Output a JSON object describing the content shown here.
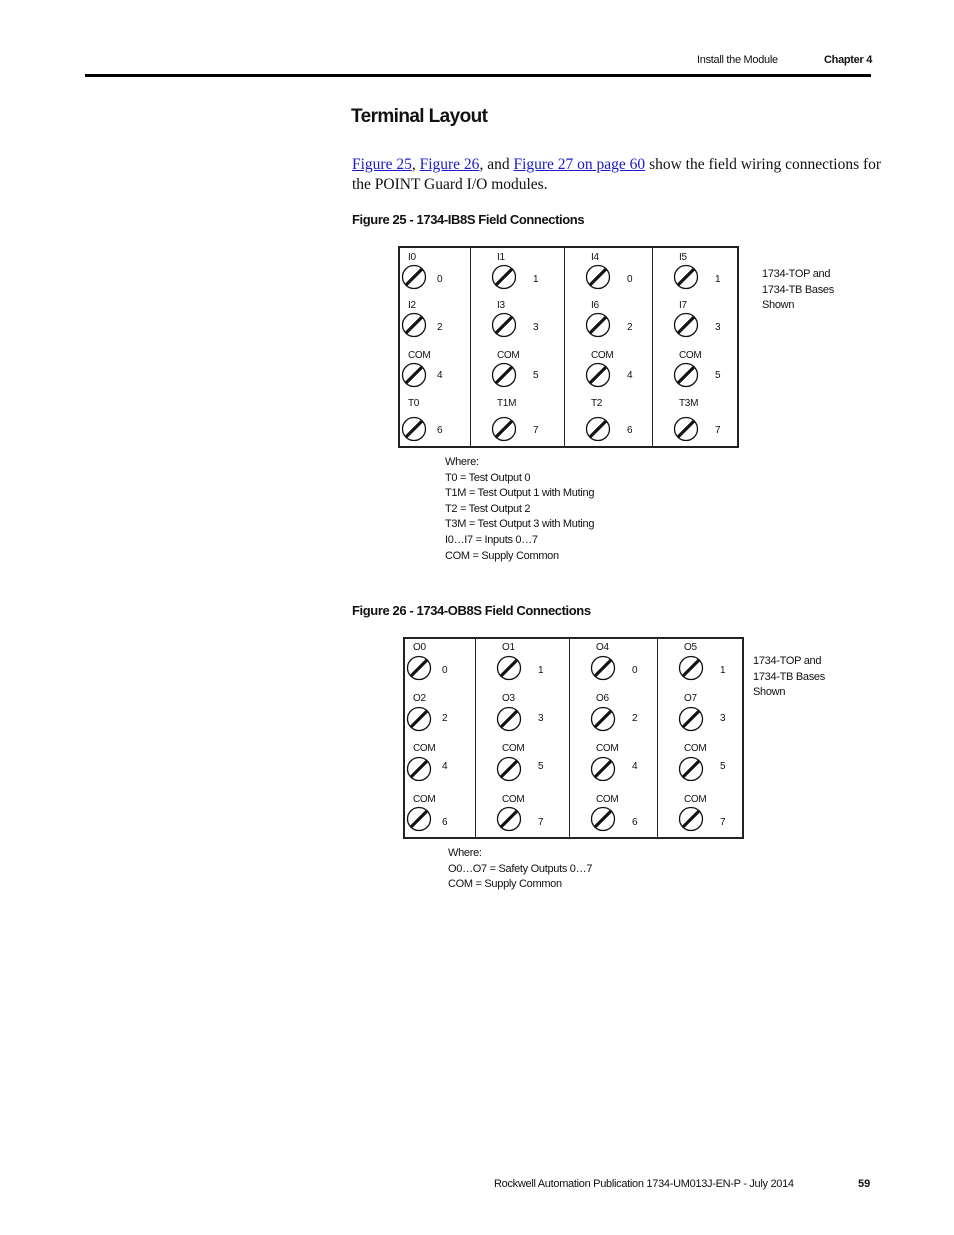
{
  "header": {
    "section": "Install the Module",
    "chapter": "Chapter 4"
  },
  "title": "Terminal Layout",
  "intro": {
    "links": [
      "Figure 25",
      "Figure 26",
      "Figure 27 on page 60"
    ],
    "sep1": ", ",
    "sep2": ", and ",
    "text": " show the field wiring connections for the POINT Guard I/O modules."
  },
  "figures": [
    {
      "caption": "Figure 25 - 1734-IB8S Field Connections",
      "side_note": [
        "1734-TOP and",
        "1734-TB Bases",
        "Shown"
      ],
      "columns": [
        [
          {
            "label": "I0",
            "num": "0"
          },
          {
            "label": "I2",
            "num": "2"
          },
          {
            "label": "COM",
            "num": "4"
          },
          {
            "label": "T0",
            "num": "6"
          }
        ],
        [
          {
            "label": "I1",
            "num": "1"
          },
          {
            "label": "I3",
            "num": "3"
          },
          {
            "label": "COM",
            "num": "5"
          },
          {
            "label": "T1M",
            "num": "7"
          }
        ],
        [
          {
            "label": "I4",
            "num": "0"
          },
          {
            "label": "I6",
            "num": "2"
          },
          {
            "label": "COM",
            "num": "4"
          },
          {
            "label": "T2",
            "num": "6"
          }
        ],
        [
          {
            "label": "I5",
            "num": "1"
          },
          {
            "label": "I7",
            "num": "3"
          },
          {
            "label": "COM",
            "num": "5"
          },
          {
            "label": "T3M",
            "num": "7"
          }
        ]
      ],
      "legend": [
        "Where:",
        "T0 = Test Output 0",
        "T1M = Test Output 1 with Muting",
        "T2 = Test Output 2",
        "T3M = Test Output 3 with Muting",
        "I0…I7 = Inputs 0…7",
        "COM = Supply Common"
      ]
    },
    {
      "caption": "Figure 26 - 1734-OB8S Field Connections",
      "side_note": [
        "1734-TOP and",
        "1734-TB Bases",
        "Shown"
      ],
      "columns": [
        [
          {
            "label": "O0",
            "num": "0"
          },
          {
            "label": "O2",
            "num": "2"
          },
          {
            "label": "COM",
            "num": "4"
          },
          {
            "label": "COM",
            "num": "6"
          }
        ],
        [
          {
            "label": "O1",
            "num": "1"
          },
          {
            "label": "O3",
            "num": "3"
          },
          {
            "label": "COM",
            "num": "5"
          },
          {
            "label": "COM",
            "num": "7"
          }
        ],
        [
          {
            "label": "O4",
            "num": "0"
          },
          {
            "label": "O6",
            "num": "2"
          },
          {
            "label": "COM",
            "num": "4"
          },
          {
            "label": "COM",
            "num": "6"
          }
        ],
        [
          {
            "label": "O5",
            "num": "1"
          },
          {
            "label": "O7",
            "num": "3"
          },
          {
            "label": "COM",
            "num": "5"
          },
          {
            "label": "COM",
            "num": "7"
          }
        ]
      ],
      "legend": [
        "Where:",
        "O0…O7 = Safety Outputs 0…7",
        "COM = Supply Common"
      ]
    }
  ],
  "footer": {
    "publication": "Rockwell Automation Publication 1734-UM013J-EN-P - July 2014",
    "page": "59"
  }
}
